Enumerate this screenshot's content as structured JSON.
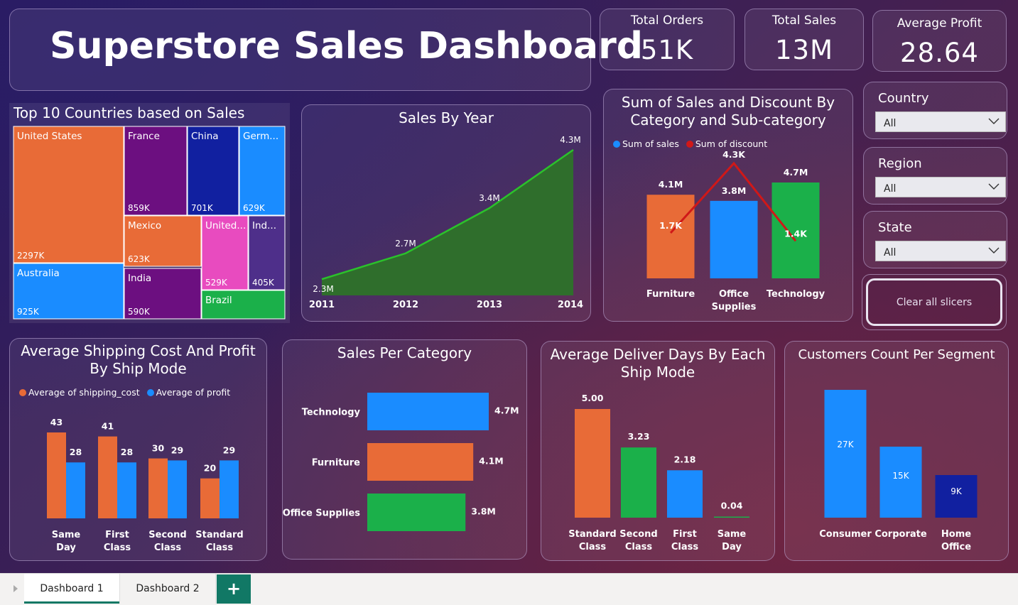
{
  "header": {
    "title": "Superstore Sales Dashboard"
  },
  "kpis": [
    {
      "label": "Total Orders",
      "value": "51K"
    },
    {
      "label": "Total Sales",
      "value": "13M"
    },
    {
      "label": "Average Profit",
      "value": "28.64"
    }
  ],
  "slicers": [
    {
      "title": "Country",
      "value": "All"
    },
    {
      "title": "Region",
      "value": "All"
    },
    {
      "title": "State",
      "value": "All"
    }
  ],
  "clear_button": {
    "label": "Clear all slicers"
  },
  "tabs": {
    "items": [
      "Dashboard 1",
      "Dashboard 2"
    ],
    "active": "Dashboard 1",
    "add_label": "+"
  },
  "colors": {
    "orange": "#e86b37",
    "blue": "#1a8cff",
    "green": "#1bb04a",
    "purple": "#6c0f80",
    "navy": "#1120a0",
    "pink": "#e84bbf",
    "dark_purple": "#4e2f8a",
    "red": "#d01818",
    "area_green": "#2f6e2c",
    "line_green": "#2bc22b"
  },
  "charts": {
    "treemap": {
      "title": "Top 10 Countries based on Sales",
      "cells": [
        {
          "name": "United States",
          "value": "2297K",
          "color": "orange"
        },
        {
          "name": "France",
          "value": "859K",
          "color": "purple"
        },
        {
          "name": "China",
          "value": "701K",
          "color": "navy"
        },
        {
          "name": "Germ...",
          "value": "629K",
          "color": "blue"
        },
        {
          "name": "Mexico",
          "value": "623K",
          "color": "orange"
        },
        {
          "name": "United...",
          "value": "529K",
          "color": "pink"
        },
        {
          "name": "Ind...",
          "value": "405K",
          "color": "dark_purple"
        },
        {
          "name": "Australia",
          "value": "925K",
          "color": "blue"
        },
        {
          "name": "India",
          "value": "590K",
          "color": "purple"
        },
        {
          "name": "Brazil",
          "value": "",
          "color": "green"
        }
      ]
    },
    "sales_by_year": {
      "title": "Sales By Year"
    },
    "sales_discount": {
      "title_line1": "Sum of Sales and Discount By",
      "title_line2": "Category and Sub-category",
      "legend": [
        "Sum of sales",
        "Sum of discount"
      ]
    },
    "shipping_profit": {
      "title_line1": "Average Shipping Cost And Profit",
      "title_line2": "By Ship Mode",
      "legend": [
        "Average of shipping_cost",
        "Average of profit"
      ]
    },
    "sales_per_category": {
      "title": "Sales Per Category"
    },
    "deliver_days": {
      "title_line1": "Average Deliver Days By Each",
      "title_line2": "Ship Mode"
    },
    "customers_segment": {
      "title": "Customers Count Per Segment"
    }
  },
  "chart_data": [
    {
      "type": "area",
      "title": "Sales By Year",
      "categories": [
        "2011",
        "2012",
        "2013",
        "2014"
      ],
      "values": [
        2.3,
        2.7,
        3.4,
        4.3
      ],
      "labels": [
        "2.3M",
        "2.7M",
        "3.4M",
        "4.3M"
      ],
      "ylim": [
        0,
        4.3
      ]
    },
    {
      "type": "bar",
      "title": "Sum of Sales and Discount By Category and Sub-category",
      "categories": [
        "Furniture",
        "Office Supplies",
        "Technology"
      ],
      "series": [
        {
          "name": "Sum of sales",
          "values": [
            4.1,
            3.8,
            4.7
          ],
          "labels": [
            "4.1M",
            "3.8M",
            "4.7M"
          ],
          "colors": [
            "orange",
            "blue",
            "green"
          ]
        },
        {
          "name": "Sum of discount",
          "values": [
            1.7,
            4.3,
            1.4
          ],
          "labels": [
            "1.7K",
            "4.3K",
            "1.4K"
          ],
          "type": "line"
        }
      ],
      "ylim": [
        0,
        5.9
      ]
    },
    {
      "type": "bar",
      "title": "Average Shipping Cost And Profit By Ship Mode",
      "categories": [
        "Same Day",
        "First Class",
        "Second Class",
        "Standard Class"
      ],
      "series": [
        {
          "name": "Average of shipping_cost",
          "values": [
            43,
            41,
            30,
            20
          ]
        },
        {
          "name": "Average of profit",
          "values": [
            28,
            28,
            29,
            29
          ]
        }
      ],
      "ylim": [
        0,
        43
      ]
    },
    {
      "type": "bar",
      "orientation": "horizontal",
      "title": "Sales Per Category",
      "categories": [
        "Technology",
        "Furniture",
        "Office Supplies"
      ],
      "values": [
        4.7,
        4.1,
        3.8
      ],
      "labels": [
        "4.7M",
        "4.1M",
        "3.8M"
      ],
      "xlim": [
        0,
        4.7
      ]
    },
    {
      "type": "bar",
      "title": "Average Deliver Days By Each Ship Mode",
      "categories": [
        "Standard Class",
        "Second Class",
        "First Class",
        "Same Day"
      ],
      "values": [
        5.0,
        3.23,
        2.18,
        0.04
      ],
      "labels": [
        "5.00",
        "3.23",
        "2.18",
        "0.04"
      ],
      "ylim": [
        0,
        5.0
      ]
    },
    {
      "type": "bar",
      "title": "Customers Count Per Segment",
      "categories": [
        "Consumer",
        "Corporate",
        "Home Office"
      ],
      "values": [
        27,
        15,
        9
      ],
      "labels": [
        "27K",
        "15K",
        "9K"
      ],
      "ylim": [
        0,
        27
      ]
    }
  ]
}
